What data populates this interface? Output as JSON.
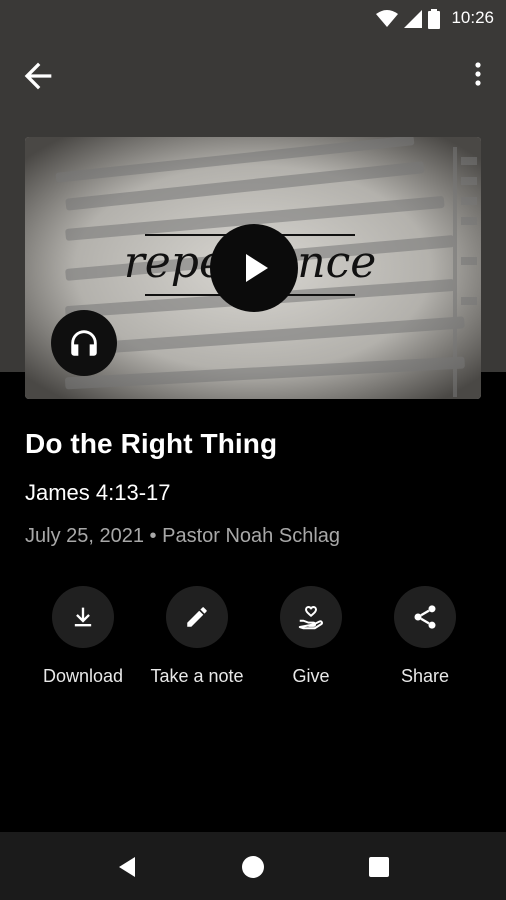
{
  "status_bar": {
    "time": "10:26"
  },
  "thumbnail": {
    "overlay_word": "repentance"
  },
  "sermon": {
    "title": "Do the Right Thing",
    "scripture": "James 4:13-17",
    "date": "July 25, 2021",
    "separator": "•",
    "speaker": "Pastor Noah Schlag"
  },
  "actions": [
    {
      "label": "Download",
      "icon": "download-icon"
    },
    {
      "label": "Take a note",
      "icon": "pencil-icon"
    },
    {
      "label": "Give",
      "icon": "give-heart-hand-icon"
    },
    {
      "label": "Share",
      "icon": "share-icon"
    }
  ],
  "icons": {
    "back": "arrow-back-icon",
    "more": "more-vert-icon",
    "play": "play-icon",
    "audio": "headphones-icon",
    "nav_back": "nav-back-icon",
    "nav_home": "nav-home-icon",
    "nav_recents": "nav-recents-icon"
  },
  "colors": {
    "background": "#000000",
    "header": "#3a3937",
    "action_circle": "#202020",
    "meta_text": "#a8a8a8"
  }
}
